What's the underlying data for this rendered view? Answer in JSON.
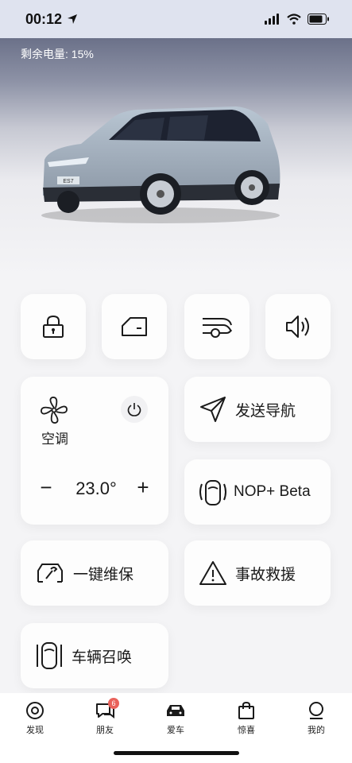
{
  "status": {
    "time": "00:12"
  },
  "hero": {
    "battery_text": "剩余电量: 15%",
    "plate_text": "ES7"
  },
  "quick_actions": [
    {
      "icon": "lock-icon"
    },
    {
      "icon": "car-door-icon"
    },
    {
      "icon": "tailgate-icon"
    },
    {
      "icon": "speaker-icon"
    }
  ],
  "climate": {
    "label": "空调",
    "temperature": "23.0°",
    "minus": "−",
    "plus": "+"
  },
  "tiles": {
    "send_nav": "发送导航",
    "nop": "NOP+ Beta",
    "maintenance": "一键维保",
    "rescue": "事故救援",
    "summon": "车辆召唤"
  },
  "nav": {
    "items": [
      {
        "label": "发现"
      },
      {
        "label": "朋友",
        "badge": "6"
      },
      {
        "label": "爱车"
      },
      {
        "label": "惊喜"
      },
      {
        "label": "我的"
      }
    ]
  },
  "colors": {
    "badge": "#e9625b",
    "icon": "#1a1a1a",
    "hero_top": "#6b7189"
  }
}
